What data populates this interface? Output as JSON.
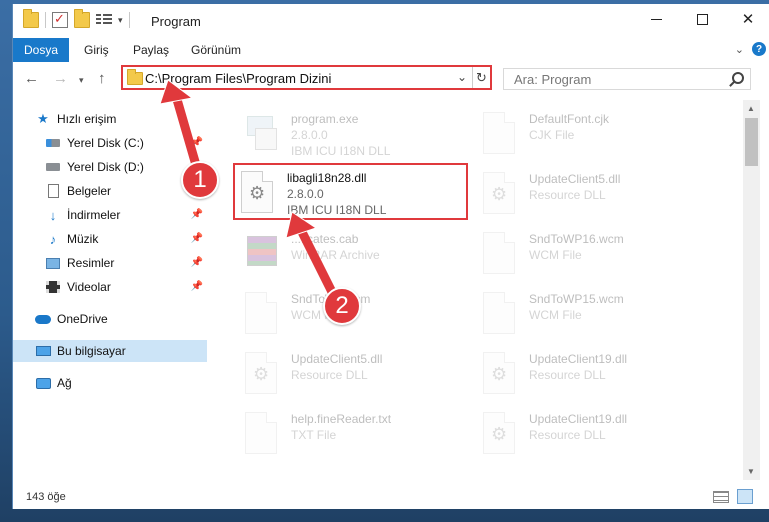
{
  "window": {
    "title": "Program",
    "controls": {
      "minimize": "–",
      "maximize": "",
      "close": "✕"
    }
  },
  "ribbon": {
    "tabs": [
      "Dosya",
      "Giriş",
      "Paylaş",
      "Görünüm"
    ],
    "help": "?"
  },
  "nav": {
    "address": "C:\\Program Files\\Program Dizini",
    "search_placeholder": "Ara: Program"
  },
  "sidebar": {
    "items": [
      {
        "label": "Hızlı erişim",
        "icon": "star-icon",
        "pinned": false
      },
      {
        "label": "Yerel Disk (C:)",
        "icon": "drive-icon",
        "pinned": true
      },
      {
        "label": "Yerel Disk (D:)",
        "icon": "drive-icon",
        "pinned": false
      },
      {
        "label": "Belgeler",
        "icon": "document-icon",
        "pinned": true
      },
      {
        "label": "İndirmeler",
        "icon": "download-icon",
        "pinned": true
      },
      {
        "label": "Müzik",
        "icon": "music-icon",
        "pinned": true
      },
      {
        "label": "Resimler",
        "icon": "pictures-icon",
        "pinned": true
      },
      {
        "label": "Videolar",
        "icon": "videos-icon",
        "pinned": true
      },
      {
        "label": "OneDrive",
        "icon": "cloud-icon",
        "pinned": false
      },
      {
        "label": "Bu bilgisayar",
        "icon": "computer-icon",
        "pinned": false,
        "selected": true
      },
      {
        "label": "Ağ",
        "icon": "network-icon",
        "pinned": false
      }
    ]
  },
  "files": [
    {
      "name": "program.exe",
      "line2": "2.8.0.0",
      "line3": "IBM ICU I18N DLL",
      "icon": "exe-icon",
      "faded": true
    },
    {
      "name": "DefaultFont.cjk",
      "line2": "CJK File",
      "line3": "",
      "icon": "file-icon",
      "faded": true
    },
    {
      "name": "libagli18n28.dll",
      "line2": "2.8.0.0",
      "line3": "IBM ICU I18N DLL",
      "icon": "dll-gear-icon",
      "faded": false
    },
    {
      "name": "UpdateClient5.dll",
      "line2": "Resource DLL",
      "line3": "",
      "icon": "dll-gear-icon",
      "faded": true
    },
    {
      "name": "...ficates.cab",
      "line2": "WinRAR Archive",
      "line3": "",
      "icon": "archive-icon",
      "faded": true
    },
    {
      "name": "SndToWP16.wcm",
      "line2": "WCM File",
      "line3": "",
      "icon": "file-icon",
      "faded": true
    },
    {
      "name": "SndToW...wcm",
      "line2": "WCM File",
      "line3": "",
      "icon": "file-icon",
      "faded": true
    },
    {
      "name": "SndToWP15.wcm",
      "line2": "WCM File",
      "line3": "",
      "icon": "file-icon",
      "faded": true
    },
    {
      "name": "UpdateClient5.dll",
      "line2": "Resource DLL",
      "line3": "",
      "icon": "dll-gear-icon",
      "faded": true
    },
    {
      "name": "UpdateClient19.dll",
      "line2": "Resource DLL",
      "line3": "",
      "icon": "dll-gear-icon",
      "faded": true
    },
    {
      "name": "help.fineReader.txt",
      "line2": "TXT File",
      "line3": "",
      "icon": "file-icon",
      "faded": true
    },
    {
      "name": "UpdateClient19.dll",
      "line2": "Resource DLL",
      "line3": "",
      "icon": "dll-gear-icon",
      "faded": true
    }
  ],
  "status": {
    "count": "143 öğe"
  },
  "annotations": {
    "step1": "1",
    "step2": "2",
    "accent_color": "#e0393c"
  },
  "colors": {
    "file_tab": "#1979ca",
    "selected_bg": "#cce4f7"
  }
}
